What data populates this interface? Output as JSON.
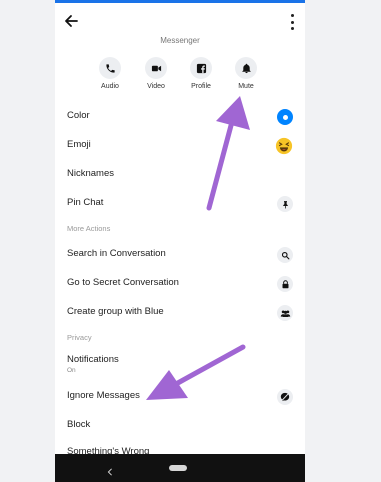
{
  "header": {
    "subtitle": "Messenger",
    "back_icon": "arrow-left-icon",
    "more_icon": "more-vertical-icon"
  },
  "actions": [
    {
      "label": "Audio",
      "icon": "phone-icon"
    },
    {
      "label": "Video",
      "icon": "video-camera-icon"
    },
    {
      "label": "Profile",
      "icon": "facebook-icon"
    },
    {
      "label": "Mute",
      "icon": "bell-icon"
    }
  ],
  "settings": {
    "color": {
      "label": "Color",
      "swatch": "#0084ff"
    },
    "emoji": {
      "label": "Emoji",
      "value": "😝"
    },
    "nicknames": {
      "label": "Nicknames"
    },
    "pin_chat": {
      "label": "Pin Chat",
      "icon": "pin-icon"
    }
  },
  "more_actions": {
    "heading": "More Actions",
    "search": {
      "label": "Search in Conversation",
      "icon": "search-icon"
    },
    "secret": {
      "label": "Go to Secret Conversation",
      "icon": "lock-icon"
    },
    "group": {
      "label": "Create group with Blue",
      "icon": "group-icon"
    }
  },
  "privacy": {
    "heading": "Privacy",
    "notifications": {
      "label": "Notifications",
      "status": "On"
    },
    "ignore": {
      "label": "Ignore Messages",
      "icon": "ignore-icon"
    },
    "block": {
      "label": "Block"
    },
    "wrong": {
      "label": "Something's Wrong"
    }
  },
  "annotations": {
    "arrow_color": "#a066d3"
  },
  "colors": {
    "accent": "#0084ff",
    "status_bar": "#1a73e8",
    "nav_bar": "#111111"
  }
}
